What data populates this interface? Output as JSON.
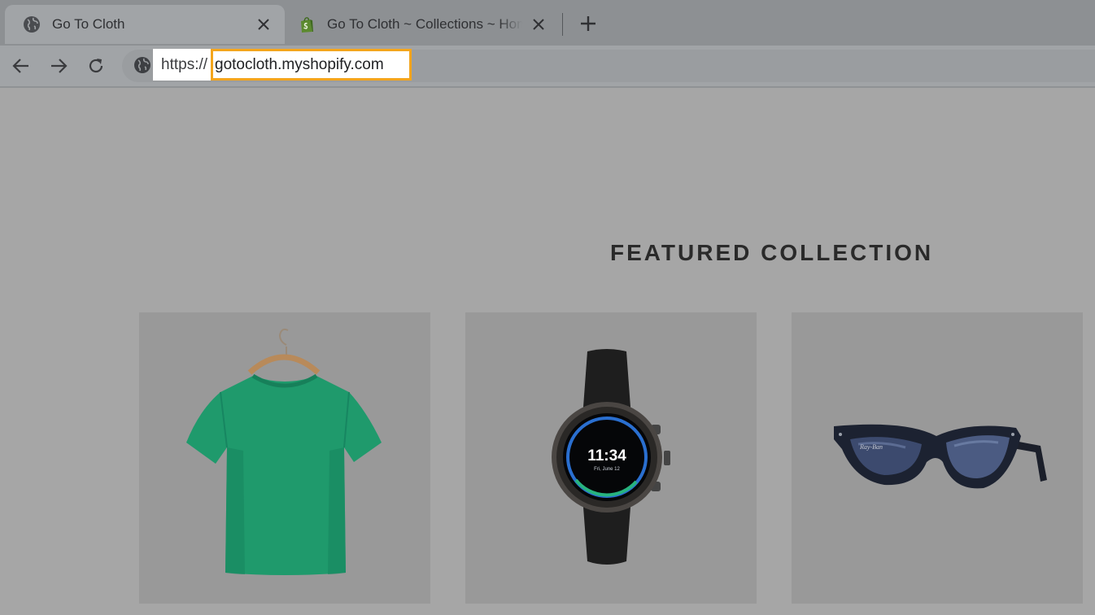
{
  "tabs": [
    {
      "title": "Go To Cloth",
      "favicon": "globe-icon",
      "active": true
    },
    {
      "title": "Go To Cloth ~ Collections ~ Home",
      "favicon": "shopify-bag-icon",
      "active": false
    }
  ],
  "toolbar": {
    "back_icon": "arrow-left-icon",
    "forward_icon": "arrow-right-icon",
    "reload_icon": "reload-icon",
    "url_scheme": "https://",
    "url_host": "gotocloth.myshopify.com",
    "highlight_color": "#f4a51c"
  },
  "page": {
    "section_title": "FEATURED COLLECTION",
    "products": [
      {
        "image": "green-tshirt-on-hanger"
      },
      {
        "image": "smartwatch",
        "watch_time": "11:34",
        "watch_date": "Fri, June 12"
      },
      {
        "image": "sunglasses",
        "brand_mark": "Ray-Ban"
      }
    ]
  },
  "colors": {
    "tshirt": "#1f9a6c",
    "page_overlay": "#a6a6a6"
  }
}
